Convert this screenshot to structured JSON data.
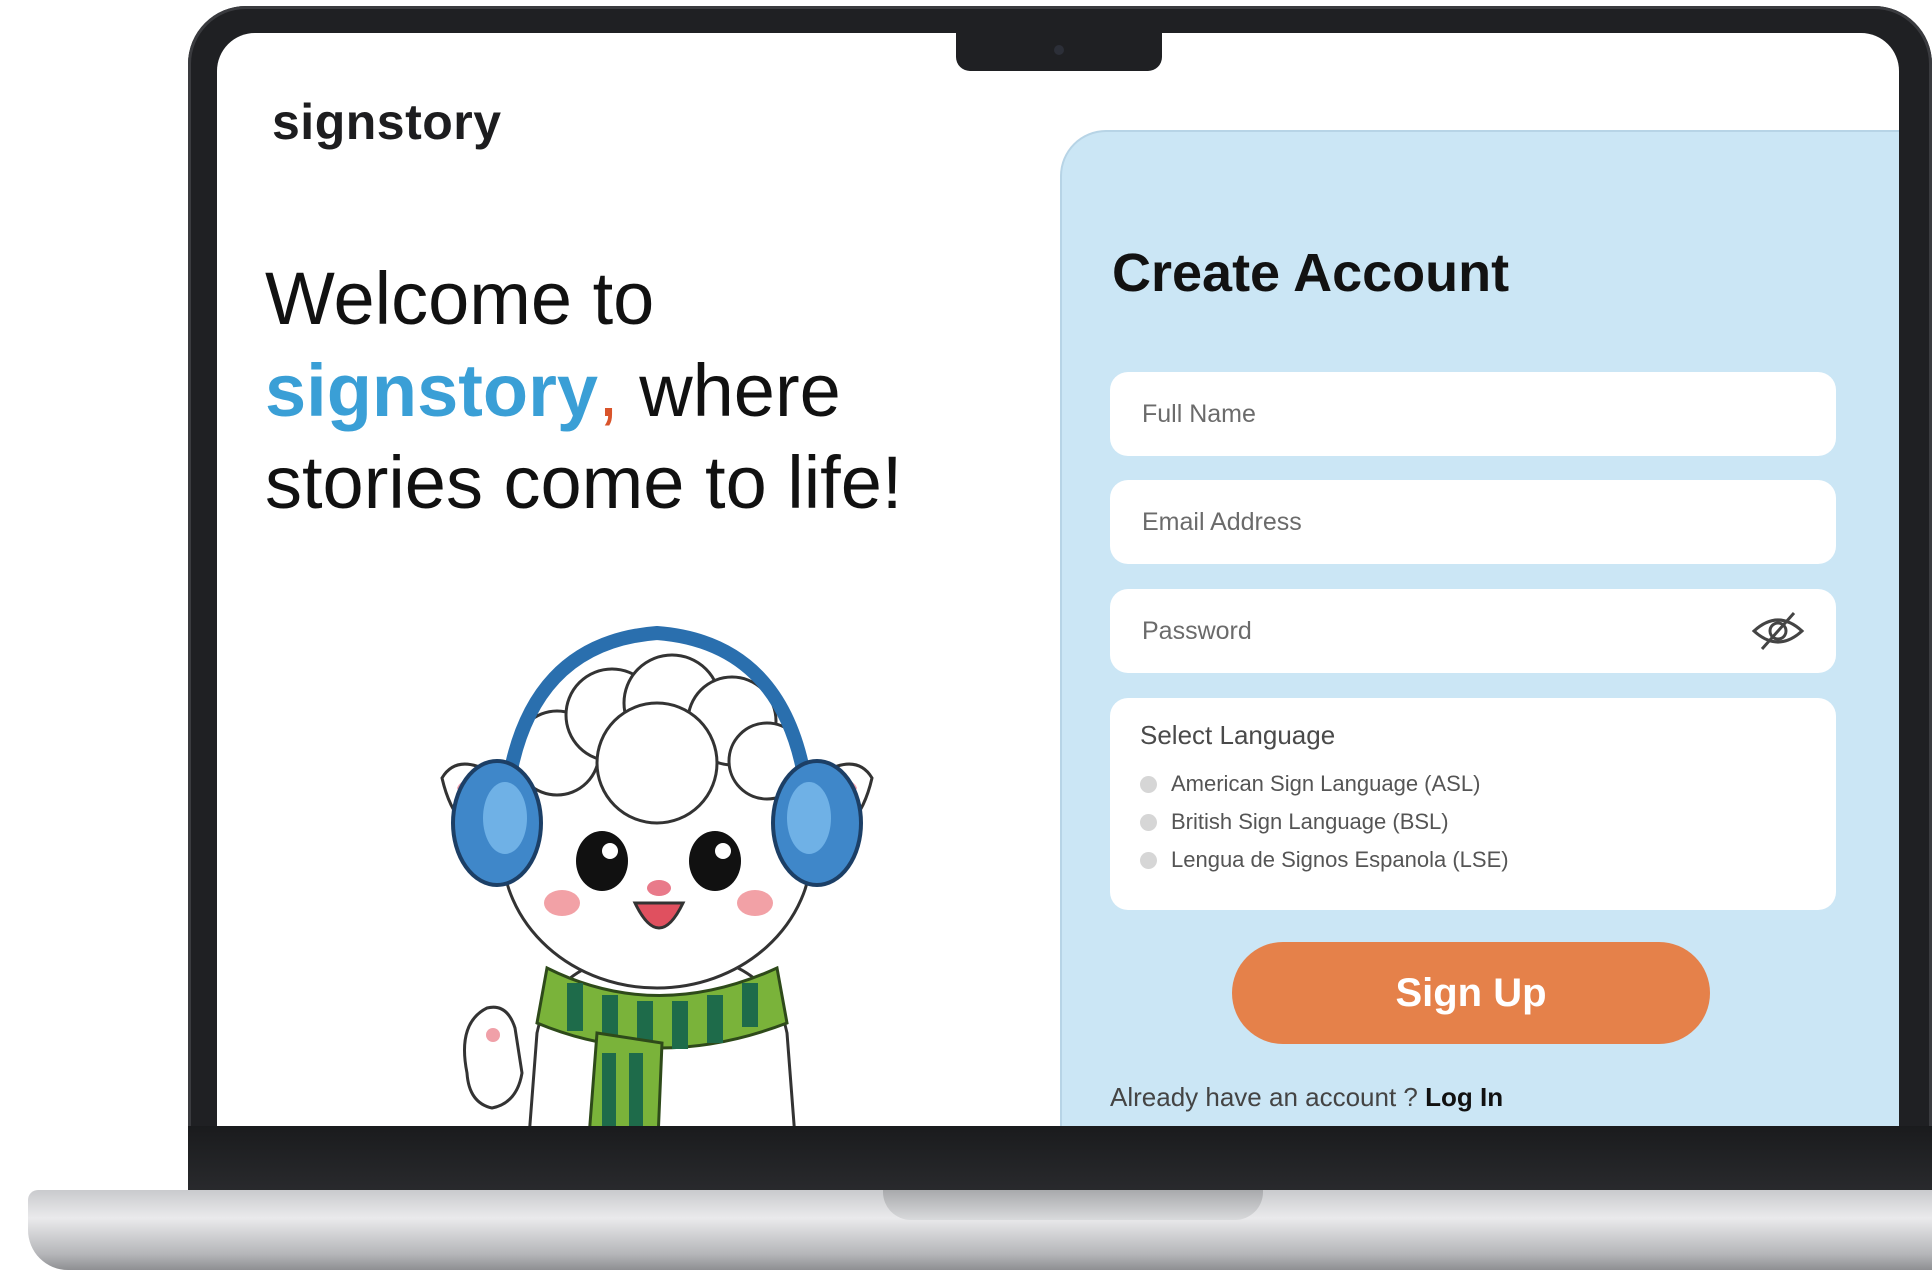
{
  "app": {
    "logo": "signstory"
  },
  "hero": {
    "line1": "Welcome to",
    "brand": "signstory",
    "comma": ",",
    "line2_rest": " where",
    "line3": "stories come to life!",
    "mascot_icon": "lamb-mascot-with-earmuffs-icon"
  },
  "form": {
    "title": "Create Account",
    "full_name": {
      "placeholder": "Full Name",
      "value": ""
    },
    "email": {
      "placeholder": "Email Address",
      "value": ""
    },
    "password": {
      "placeholder": "Password",
      "value": "",
      "icon": "eye-slash-icon"
    },
    "language": {
      "title": "Select Language",
      "options": [
        {
          "label": "American Sign Language (ASL)",
          "selected": false
        },
        {
          "label": "British Sign Language (BSL)",
          "selected": false
        },
        {
          "label": "Lengua de Signos Espanola (LSE)",
          "selected": false
        }
      ]
    },
    "signup_label": "Sign Up",
    "login_prompt": "Already have an account ? ",
    "login_label": "Log In"
  },
  "colors": {
    "brand_blue": "#3a9fd6",
    "accent_orange": "#e5814a",
    "panel_bg": "#cbe6f5",
    "comma_red": "#d9542b"
  }
}
